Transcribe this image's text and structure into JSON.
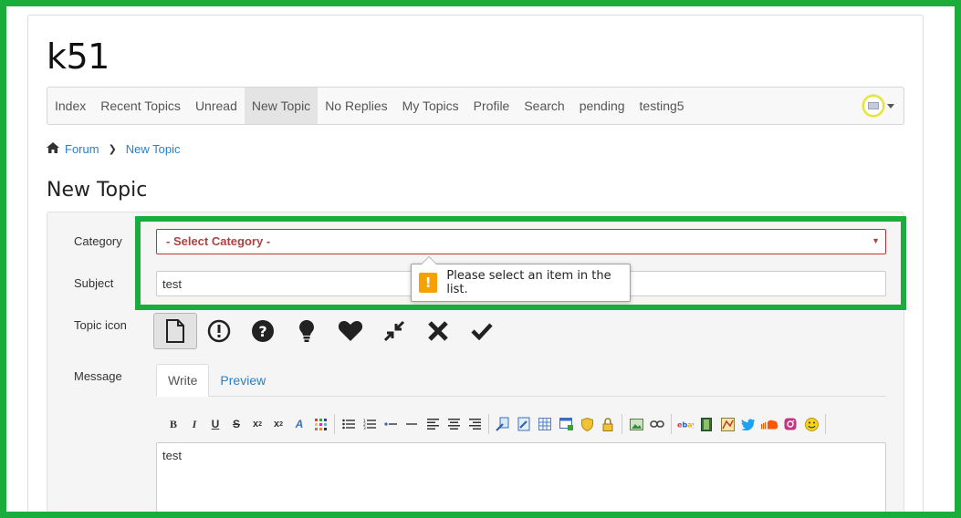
{
  "site": {
    "title": "k51"
  },
  "nav": {
    "items": [
      "Index",
      "Recent Topics",
      "Unread",
      "New Topic",
      "No Replies",
      "My Topics",
      "Profile",
      "Search",
      "pending",
      "testing5"
    ],
    "active_index": 3
  },
  "breadcrumb": {
    "home": "Forum",
    "current": "New Topic"
  },
  "page": {
    "heading": "New Topic"
  },
  "form": {
    "category_label": "Category",
    "category_value": "- Select Category -",
    "subject_label": "Subject",
    "subject_value": "test",
    "topic_icon_label": "Topic icon",
    "message_label": "Message",
    "tabs": [
      "Write",
      "Preview"
    ],
    "message_value": "test"
  },
  "tooltip": {
    "text": "Please select an item in the list."
  },
  "colors": {
    "highlight": "#1aad3c",
    "link": "#2a7fc9",
    "error": "#a94442",
    "warning": "#f5a100"
  },
  "topic_icons": [
    "document-icon",
    "exclamation-circle-icon",
    "question-circle-icon",
    "lightbulb-icon",
    "heart-icon",
    "compress-icon",
    "x-icon",
    "check-icon"
  ]
}
